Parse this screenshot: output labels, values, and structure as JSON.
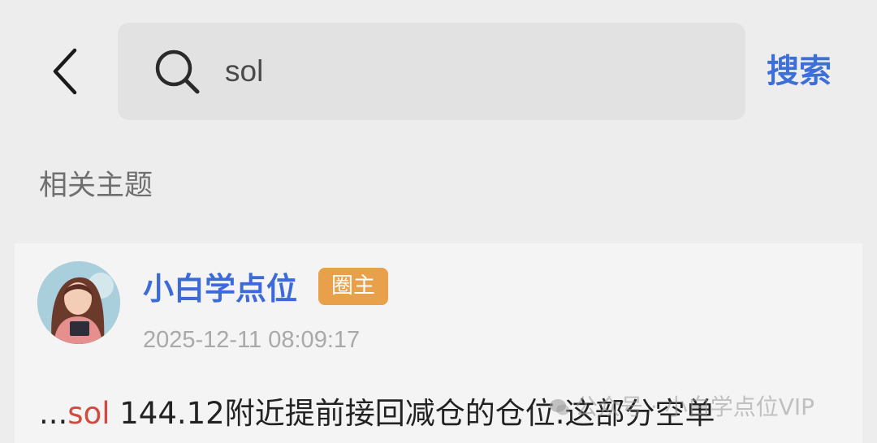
{
  "header": {
    "back_icon": "chevron-left-icon",
    "search": {
      "icon": "search-icon",
      "value": "sol",
      "placeholder": ""
    },
    "submit_label": "搜索"
  },
  "related": {
    "title": "相关主题"
  },
  "post": {
    "author": "小白学点位",
    "badge": "圈主",
    "timestamp": "2025-12-11 08:09:17",
    "excerpt_prefix": "...",
    "excerpt_keyword": "sol",
    "excerpt_rest": " 144.12附近提前接回减仓的仓位.这部分空单"
  },
  "watermark": {
    "text": "公众号 · 小白学点位VIP"
  },
  "colors": {
    "background": "#ededed",
    "accent": "#3d6fd9",
    "badge": "#e8a04a",
    "highlight": "#d04a3f"
  }
}
